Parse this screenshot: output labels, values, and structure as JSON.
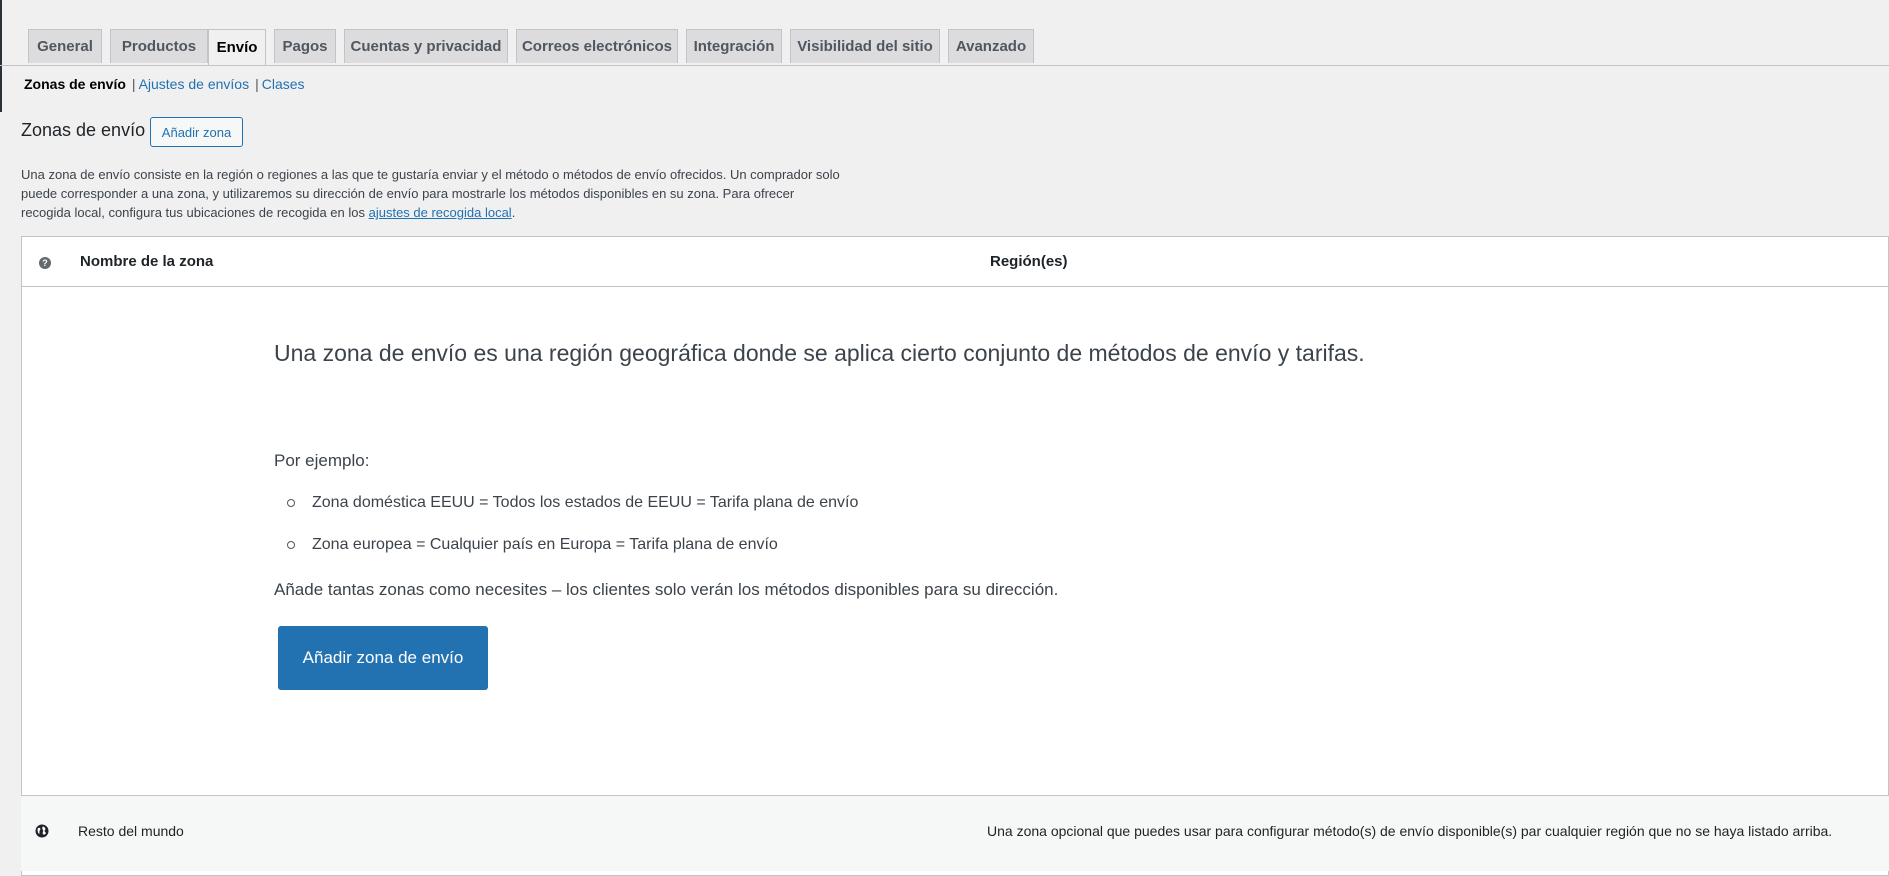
{
  "tabs": [
    {
      "label": "General"
    },
    {
      "label": "Productos"
    },
    {
      "label": "Envío",
      "active": true
    },
    {
      "label": "Pagos"
    },
    {
      "label": "Cuentas y privacidad"
    },
    {
      "label": "Correos electrónicos"
    },
    {
      "label": "Integración"
    },
    {
      "label": "Visibilidad del sitio"
    },
    {
      "label": "Avanzado"
    }
  ],
  "subnav": {
    "current": "Zonas de envío",
    "links": [
      "Ajustes de envíos",
      "Clases"
    ],
    "separator": "|"
  },
  "section": {
    "title": "Zonas de envío",
    "add_button": "Añadir zona",
    "description": "Una zona de envío consiste en la región o regiones a las que te gustaría enviar y el método o métodos de envío ofrecidos. Un comprador solo puede corresponder a una zona, y utilizaremos su dirección de envío para mostrarle los métodos disponibles en su zona. Para ofrecer recogida local, configura tus ubicaciones de recogida en los ",
    "description_link": "ajustes de recogida local",
    "description_end": "."
  },
  "table": {
    "help_icon": "?",
    "col_name": "Nombre de la zona",
    "col_region": "Región(es)"
  },
  "empty_state": {
    "heading": "Una zona de envío es una región geográfica donde se aplica cierto conjunto de métodos de envío y tarifas.",
    "intro": "Por ejemplo:",
    "examples": [
      "Zona doméstica EEUU = Todos los estados de EEUU = Tarifa plana de envío",
      "Zona europea = Cualquier país en Europa = Tarifa plana de envío"
    ],
    "outro": "Añade tantas zonas como necesites – los clientes solo verán los métodos disponibles para su dirección.",
    "button": "Añadir zona de envío"
  },
  "rest_of_world": {
    "name": "Resto del mundo",
    "description": "Una zona opcional que puedes usar para configurar método(s) de envío disponible(s) par cualquier región que no se haya listado arriba.",
    "icon": "globe-icon"
  },
  "colors": {
    "accent": "#2271b1",
    "background": "#f0f0f1"
  }
}
